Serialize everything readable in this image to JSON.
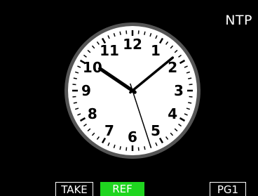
{
  "header": {
    "sync_source": "NTP"
  },
  "clock": {
    "numerals": [
      "12",
      "1",
      "2",
      "3",
      "4",
      "5",
      "6",
      "7",
      "8",
      "9",
      "10",
      "11"
    ],
    "time": {
      "hour": 10,
      "minute": 8,
      "second": 27
    },
    "colors": {
      "face": "#ffffff",
      "bezel": "#555555",
      "ticks": "#000000",
      "hands": "#000000"
    }
  },
  "footer": {
    "take_label": "TAKE",
    "ref_label": "REF",
    "ref_color": "#1fd51f",
    "page_label": "PG1"
  }
}
